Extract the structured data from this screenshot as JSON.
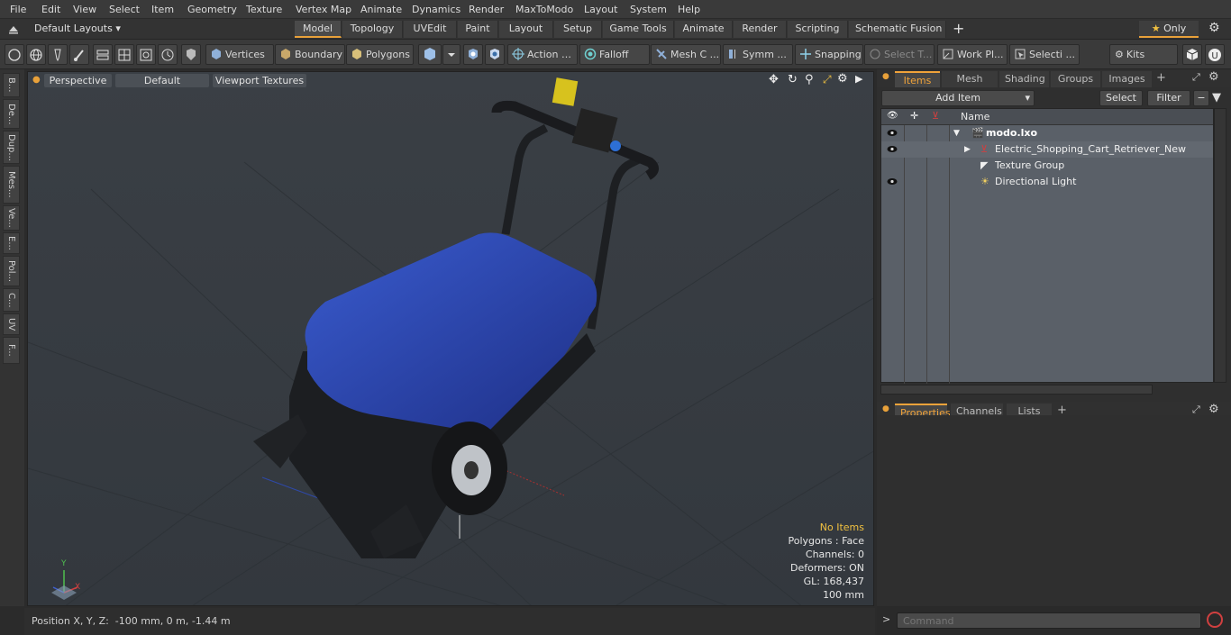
{
  "menu": [
    "File",
    "Edit",
    "View",
    "Select",
    "Item",
    "Geometry",
    "Texture",
    "Vertex Map",
    "Animate",
    "Dynamics",
    "Render",
    "MaxToModo",
    "Layout",
    "System",
    "Help"
  ],
  "layouts_label": "Default Layouts",
  "mode_tabs": [
    "Model",
    "Topology",
    "UVEdit",
    "Paint",
    "Layout",
    "Setup",
    "Game Tools",
    "Animate",
    "Render",
    "Scripting",
    "Schematic Fusion"
  ],
  "only_label": "Only",
  "toolbar": {
    "vertices": "Vertices",
    "boundary": "Boundary",
    "polygons": "Polygons",
    "action": "Action",
    "falloff": "Falloff",
    "mesh": "Mesh C ...",
    "symm": "Symm ...",
    "snapping": "Snapping",
    "select_t": "Select T...",
    "work_pl": "Work Pl...",
    "selecti": "Selecti ...",
    "kits": "Kits"
  },
  "left_tabs": [
    "B...",
    "De...",
    "Dup...",
    "Mes...",
    "Ve...",
    "E...",
    "Pol...",
    "C...",
    "UV",
    "F..."
  ],
  "viewport": {
    "perspective": "Perspective",
    "default": "Default",
    "viewport_textures": "Viewport Textures",
    "hud": {
      "no_items": "No Items",
      "polygons": "Polygons : Face",
      "channels": "Channels: 0",
      "deformers": "Deformers: ON",
      "gl": "GL: 168,437",
      "scale": "100 mm"
    },
    "axis_x": "X",
    "axis_y": "Y"
  },
  "status": "Position X, Y, Z:  -100 mm, 0 m, -1.44 m",
  "items_panel": {
    "tabs": [
      "Items",
      "Mesh Ops",
      "Shading",
      "Groups",
      "Images"
    ],
    "add_item": "Add Item",
    "select": "Select",
    "filter": "Filter",
    "name_header": "Name",
    "tree": [
      {
        "label": "modo.lxo",
        "indent": 0
      },
      {
        "label": "Electric_Shopping_Cart_Retriever_New",
        "indent": 1
      },
      {
        "label": "Texture Group",
        "indent": 1
      },
      {
        "label": "Directional Light",
        "indent": 1
      }
    ]
  },
  "props_tabs": [
    "Properties",
    "Channels",
    "Lists"
  ],
  "command_placeholder": "Command"
}
